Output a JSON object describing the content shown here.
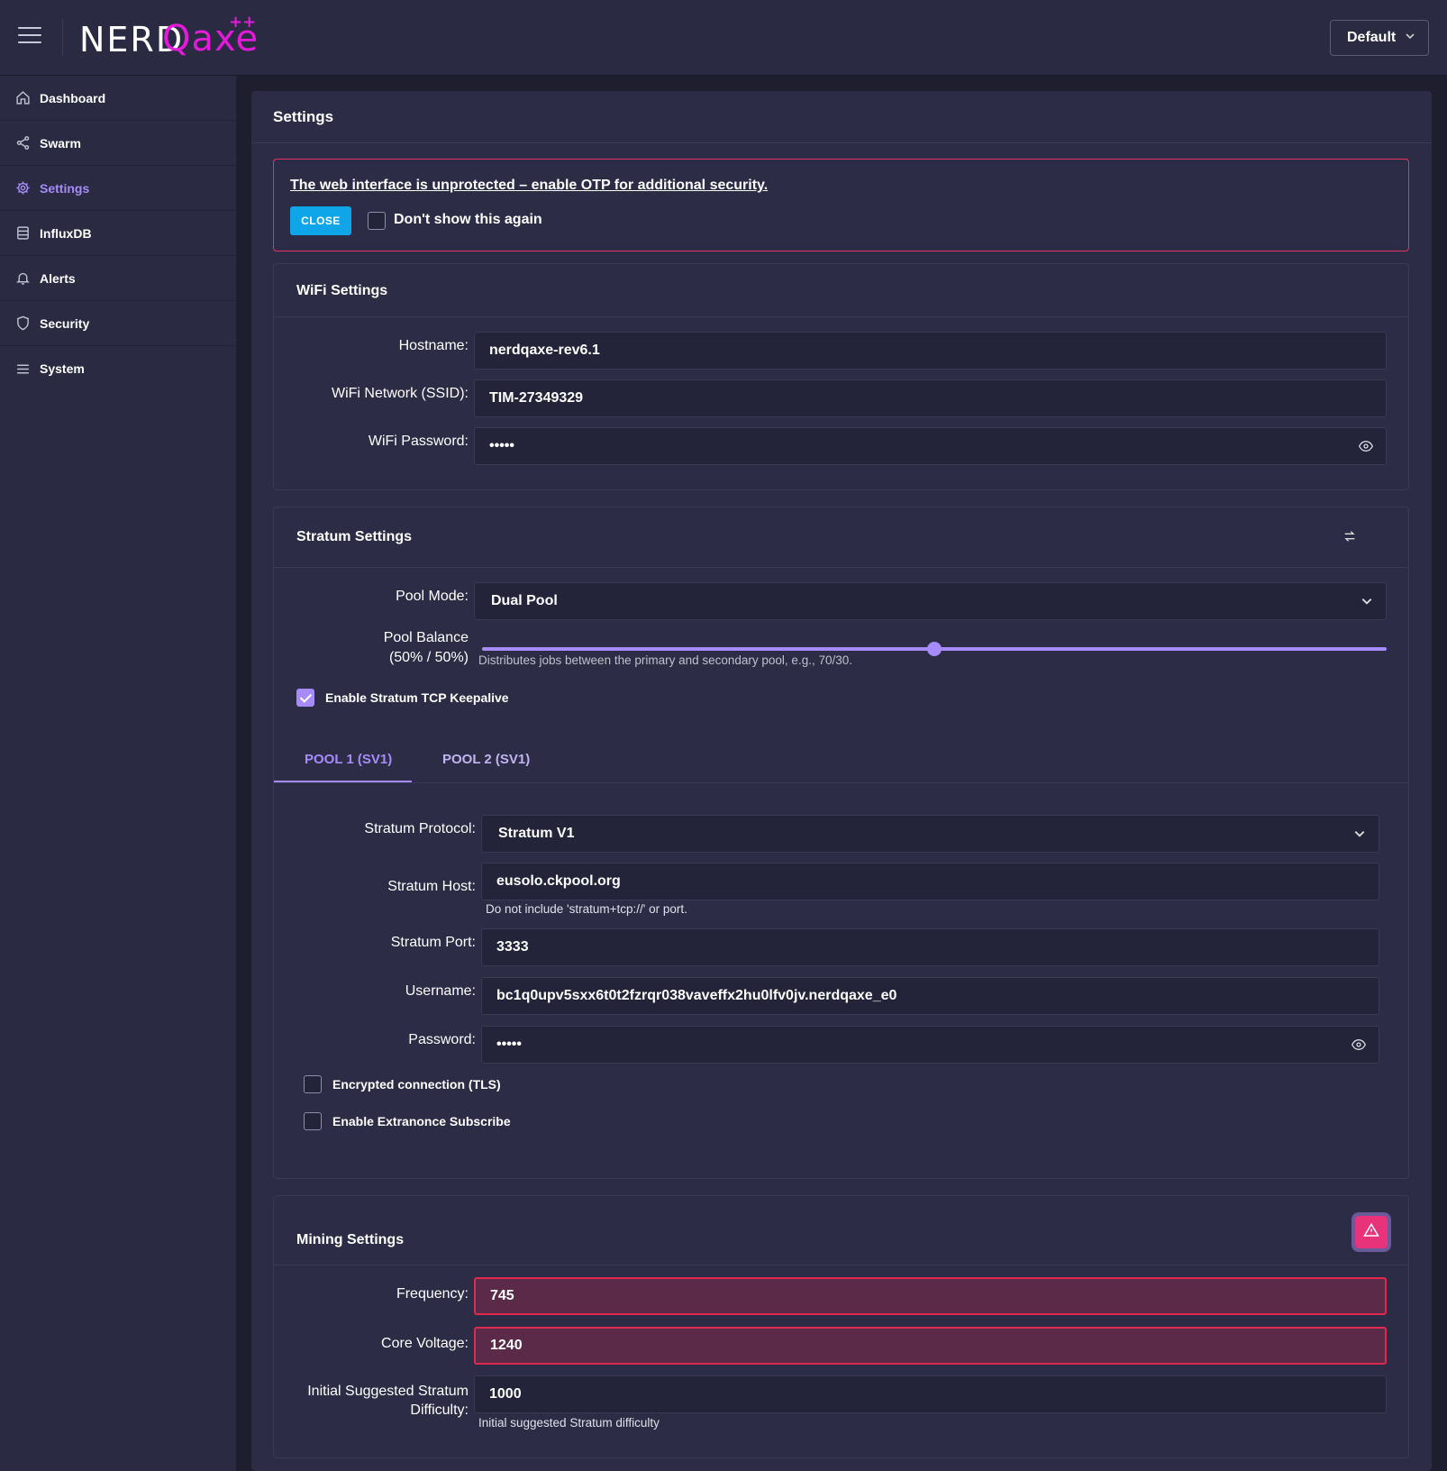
{
  "header": {
    "logo_text_a": "NERD",
    "logo_text_b": "Qaxe",
    "logo_text_c": "++",
    "theme_select": "Default"
  },
  "sidebar": {
    "items": [
      {
        "label": "Dashboard",
        "icon": "home-icon"
      },
      {
        "label": "Swarm",
        "icon": "share-icon"
      },
      {
        "label": "Settings",
        "icon": "gear-icon"
      },
      {
        "label": "InfluxDB",
        "icon": "database-icon"
      },
      {
        "label": "Alerts",
        "icon": "bell-icon"
      },
      {
        "label": "Security",
        "icon": "shield-icon"
      },
      {
        "label": "System",
        "icon": "list-icon"
      }
    ],
    "active": "Settings"
  },
  "page": {
    "title": "Settings"
  },
  "alert": {
    "message": "The web interface is unprotected – enable OTP for additional security.",
    "close_label": "CLOSE",
    "dont_show_label": "Don't show this again"
  },
  "wifi": {
    "title": "WiFi Settings",
    "hostname_label": "Hostname:",
    "hostname_value": "nerdqaxe-rev6.1",
    "ssid_label": "WiFi Network (SSID):",
    "ssid_value": "TIM-27349329",
    "password_label": "WiFi Password:",
    "password_value": "•••••"
  },
  "stratum": {
    "title": "Stratum Settings",
    "pool_mode_label": "Pool Mode:",
    "pool_mode_value": "Dual Pool",
    "pool_balance_label": "Pool Balance",
    "pool_balance_value": "(50% / 50%)",
    "pool_balance_fraction": 0.5,
    "pool_balance_hint": "Distributes jobs between the primary and secondary pool, e.g., 70/30.",
    "keepalive_label": "Enable Stratum TCP Keepalive",
    "keepalive_checked": true,
    "tabs": [
      "POOL 1 (SV1)",
      "POOL 2 (SV1)"
    ],
    "protocol_label": "Stratum Protocol:",
    "protocol_value": "Stratum V1",
    "host_label": "Stratum Host:",
    "host_value": "eusolo.ckpool.org",
    "host_hint": "Do not include 'stratum+tcp://' or port.",
    "port_label": "Stratum Port:",
    "port_value": "3333",
    "username_label": "Username:",
    "username_value": "bc1q0upv5sxx6t0t2fzrqr038vaveffx2hu0lfv0jv.nerdqaxe_e0",
    "password_label": "Password:",
    "password_value": "•••••",
    "tls_label": "Encrypted connection (TLS)",
    "extranonce_label": "Enable Extranonce Subscribe"
  },
  "mining": {
    "title": "Mining Settings",
    "frequency_label": "Frequency:",
    "frequency_value": "745",
    "voltage_label": "Core Voltage:",
    "voltage_value": "1240",
    "difficulty_label_1": "Initial Suggested Stratum",
    "difficulty_label_2": "Difficulty:",
    "difficulty_value": "1000",
    "difficulty_hint": "Initial suggested Stratum difficulty"
  },
  "colors": {
    "accent": "#a78bfa",
    "brand": "#e21bd8",
    "danger": "#e0294f",
    "info": "#0ea5e9"
  }
}
